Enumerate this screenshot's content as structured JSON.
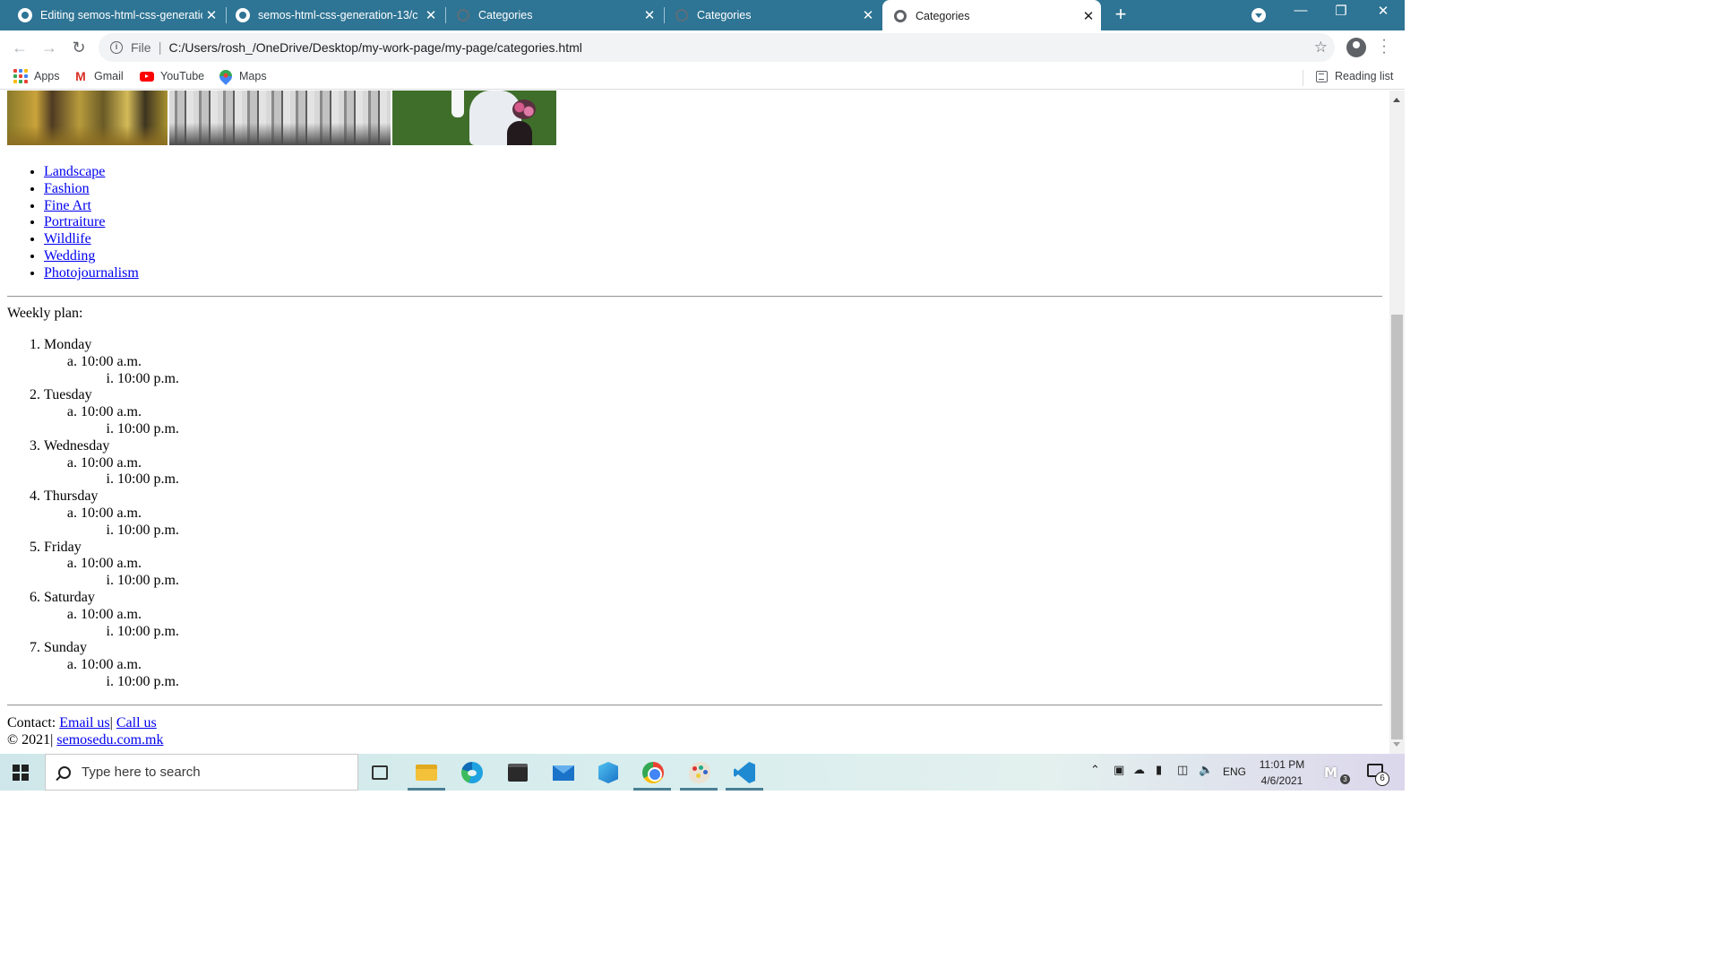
{
  "browser": {
    "tabs": [
      {
        "title": "Editing semos-html-css-generatio",
        "icon": "github-icon",
        "active": false
      },
      {
        "title": "semos-html-css-generation-13/c",
        "icon": "github-icon",
        "active": false
      },
      {
        "title": "Categories",
        "icon": "globe-icon",
        "active": false
      },
      {
        "title": "Categories",
        "icon": "globe-icon",
        "active": false
      },
      {
        "title": "Categories",
        "icon": "globe-icon",
        "active": true
      }
    ],
    "close_glyph": "✕",
    "new_tab_glyph": "+",
    "window_controls": {
      "minimize": "—",
      "restore": "❐",
      "close": "✕"
    },
    "address": {
      "scheme_label": "File",
      "url": "C:/Users/rosh_/OneDrive/Desktop/my-work-page/my-page/categories.html"
    },
    "bookmarks": [
      {
        "label": "Apps",
        "icon": "apps-icon"
      },
      {
        "label": "Gmail",
        "icon": "gmail-icon"
      },
      {
        "label": "YouTube",
        "icon": "youtube-icon"
      },
      {
        "label": "Maps",
        "icon": "maps-icon"
      }
    ],
    "reading_list": "Reading list",
    "colors": {
      "tabstrip": "#2e7494",
      "link": "#0000ee"
    }
  },
  "page": {
    "categories": [
      "Landscape",
      "Fashion",
      "Fine Art",
      "Portraiture",
      "Wildlife",
      "Wedding",
      "Photojournalism"
    ],
    "weekly_label": "Weekly plan:",
    "days": [
      {
        "name": "Monday",
        "morning": "10:00 a.m.",
        "evening": "10:00 p.m."
      },
      {
        "name": "Tuesday",
        "morning": "10:00 a.m.",
        "evening": "10:00 p.m."
      },
      {
        "name": "Wednesday",
        "morning": "10:00 a.m.",
        "evening": "10:00 p.m."
      },
      {
        "name": "Thursday",
        "morning": "10:00 a.m.",
        "evening": "10:00 p.m."
      },
      {
        "name": "Friday",
        "morning": "10:00 a.m.",
        "evening": "10:00 p.m."
      },
      {
        "name": "Saturday",
        "morning": "10:00 a.m.",
        "evening": "10:00 p.m."
      },
      {
        "name": "Sunday",
        "morning": "10:00 a.m.",
        "evening": "10:00 p.m."
      }
    ],
    "footer": {
      "contact_label": "Contact:",
      "email_link": "Email us",
      "separator": "|",
      "call_link": "Call us",
      "copyright": "© 2021|",
      "site_link": "semosedu.com.mk"
    }
  },
  "taskbar": {
    "search_placeholder": "Type here to search",
    "language": "ENG",
    "time": "11:01 PM",
    "date": "4/6/2021",
    "notification_count": "6",
    "meet_badge": "3"
  }
}
